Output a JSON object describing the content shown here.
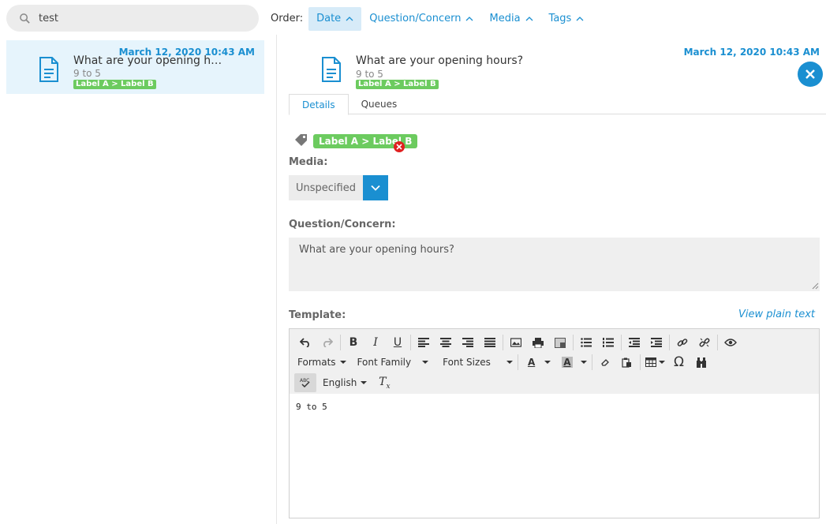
{
  "search": {
    "value": "test",
    "icon": "search-icon"
  },
  "order": {
    "label": "Order:",
    "options": [
      {
        "label": "Date",
        "active": true
      },
      {
        "label": "Question/Concern",
        "active": false
      },
      {
        "label": "Media",
        "active": false
      },
      {
        "label": "Tags",
        "active": false
      }
    ]
  },
  "list": {
    "items": [
      {
        "date": "March 12, 2020 10:43 AM",
        "title": "What are your opening ho…",
        "subtitle": "9 to 5",
        "tag": "Label A > Label B"
      }
    ]
  },
  "detail": {
    "date": "March 12, 2020 10:43 AM",
    "title": "What are your opening hours?",
    "subtitle": "9 to 5",
    "tag": "Label A > Label B",
    "tabs": [
      "Details",
      "Queues"
    ],
    "tag_chip": "Label A > Label B",
    "media_label": "Media:",
    "media_value": "Unspecified",
    "question_label": "Question/Concern:",
    "question_value": "What are your opening hours?",
    "template_label": "Template:",
    "view_plain_text": "View plain text",
    "editor": {
      "formats": "Formats",
      "font_family": "Font Family",
      "font_sizes": "Font Sizes",
      "language": "English",
      "content": "9 to 5"
    }
  },
  "colors": {
    "accent": "#1a8fd1",
    "tag": "#6ccb5f",
    "selected_bg": "#e6f4fc",
    "remove": "#e02020"
  }
}
